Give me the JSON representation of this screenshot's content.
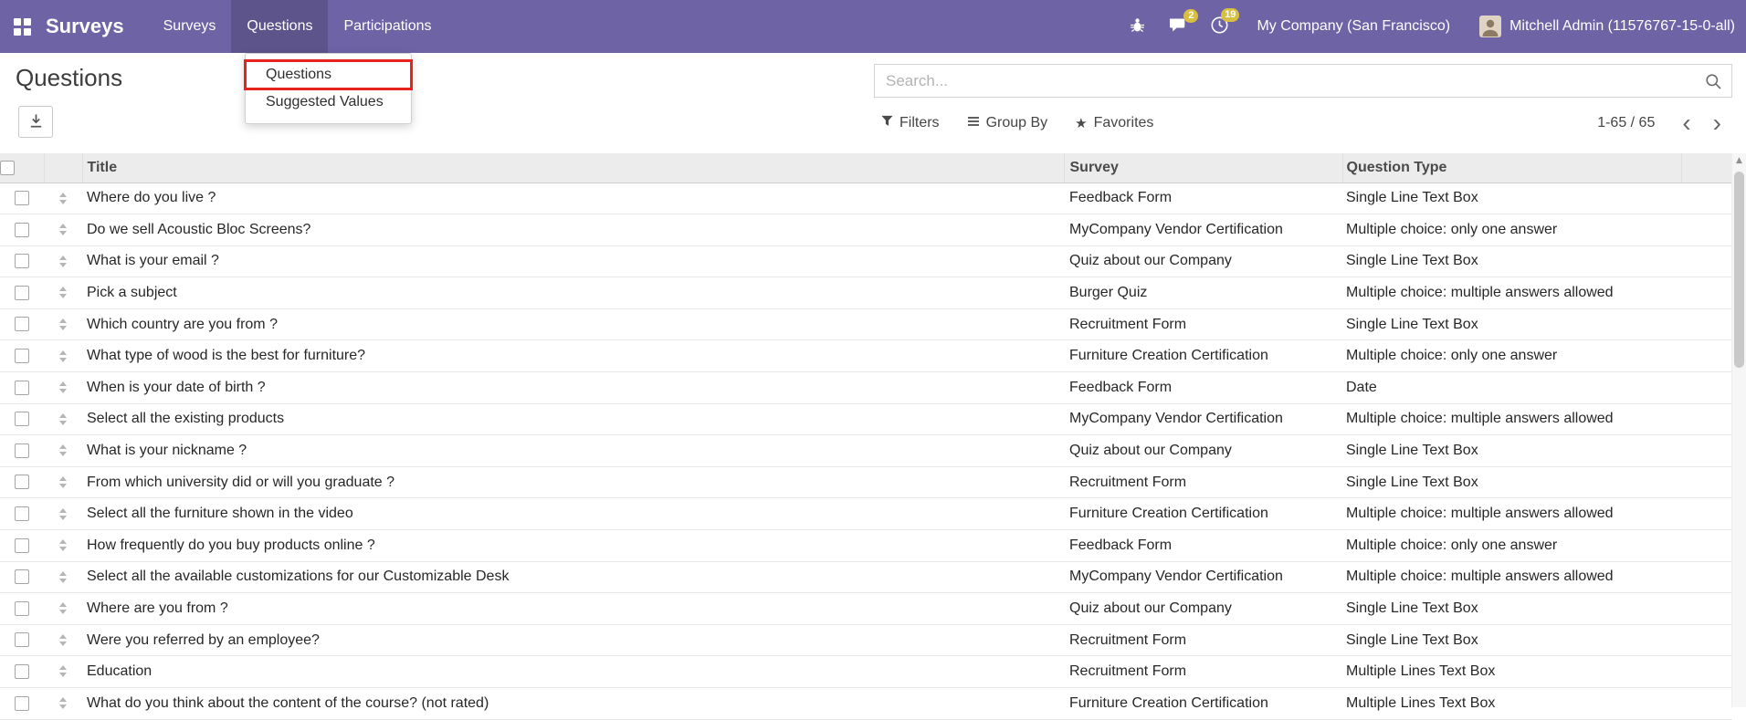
{
  "colors": {
    "navbar-bg": "#6e63a5",
    "badge-bg": "#d8bf3f",
    "annotation": "#e8231d"
  },
  "navbar": {
    "brand": "Surveys",
    "menu": [
      {
        "label": "Surveys",
        "active": false
      },
      {
        "label": "Questions",
        "active": true
      },
      {
        "label": "Participations",
        "active": false
      }
    ],
    "systray": {
      "messages_count": "2",
      "activities_count": "19",
      "company": "My Company (San Francisco)",
      "user": "Mitchell Admin (11576767-15-0-all)"
    }
  },
  "icons": {
    "apps-menu-icon": "grid-2x2",
    "bug-icon": "bug",
    "messages-icon": "chat-bubble",
    "activities-icon": "clock",
    "export-icon": "download-arrow",
    "search-icon": "magnifier",
    "filters-icon": "funnel",
    "group-by-icon": "bars",
    "favorites-icon": "star",
    "pager-prev-icon": "chevron-left",
    "pager-next-icon": "chevron-right",
    "drag-handle-icon": "sort-arrows"
  },
  "page": {
    "title": "Questions"
  },
  "menu_dropdown": {
    "items": [
      {
        "label": "Questions",
        "highlighted": true
      },
      {
        "label": "Suggested Values",
        "highlighted": false
      }
    ]
  },
  "search": {
    "placeholder": "Search..."
  },
  "filter_bar": {
    "filters": "Filters",
    "group_by": "Group By",
    "favorites": "Favorites",
    "pager": "1-65 / 65",
    "pager_prev": "‹",
    "pager_next": "›",
    "scroll_up_glyph": "▲"
  },
  "table": {
    "headers": {
      "title": "Title",
      "survey": "Survey",
      "question_type": "Question Type"
    },
    "rows": [
      {
        "title": "Where do you live ?",
        "survey": "Feedback Form",
        "question_type": "Single Line Text Box"
      },
      {
        "title": "Do we sell Acoustic Bloc Screens?",
        "survey": "MyCompany Vendor Certification",
        "question_type": "Multiple choice: only one answer"
      },
      {
        "title": "What is your email ?",
        "survey": "Quiz about our Company",
        "question_type": "Single Line Text Box"
      },
      {
        "title": "Pick a subject",
        "survey": "Burger Quiz",
        "question_type": "Multiple choice: multiple answers allowed"
      },
      {
        "title": "Which country are you from ?",
        "survey": "Recruitment Form",
        "question_type": "Single Line Text Box"
      },
      {
        "title": "What type of wood is the best for furniture?",
        "survey": "Furniture Creation Certification",
        "question_type": "Multiple choice: only one answer"
      },
      {
        "title": "When is your date of birth ?",
        "survey": "Feedback Form",
        "question_type": "Date"
      },
      {
        "title": "Select all the existing products",
        "survey": "MyCompany Vendor Certification",
        "question_type": "Multiple choice: multiple answers allowed"
      },
      {
        "title": "What is your nickname ?",
        "survey": "Quiz about our Company",
        "question_type": "Single Line Text Box"
      },
      {
        "title": "From which university did or will you graduate ?",
        "survey": "Recruitment Form",
        "question_type": "Single Line Text Box"
      },
      {
        "title": "Select all the furniture shown in the video",
        "survey": "Furniture Creation Certification",
        "question_type": "Multiple choice: multiple answers allowed"
      },
      {
        "title": "How frequently do you buy products online ?",
        "survey": "Feedback Form",
        "question_type": "Multiple choice: only one answer"
      },
      {
        "title": "Select all the available customizations for our Customizable Desk",
        "survey": "MyCompany Vendor Certification",
        "question_type": "Multiple choice: multiple answers allowed"
      },
      {
        "title": "Where are you from ?",
        "survey": "Quiz about our Company",
        "question_type": "Single Line Text Box"
      },
      {
        "title": "Were you referred by an employee?",
        "survey": "Recruitment Form",
        "question_type": "Single Line Text Box"
      },
      {
        "title": "Education",
        "survey": "Recruitment Form",
        "question_type": "Multiple Lines Text Box"
      },
      {
        "title": "What do you think about the content of the course? (not rated)",
        "survey": "Furniture Creation Certification",
        "question_type": "Multiple Lines Text Box"
      }
    ]
  }
}
